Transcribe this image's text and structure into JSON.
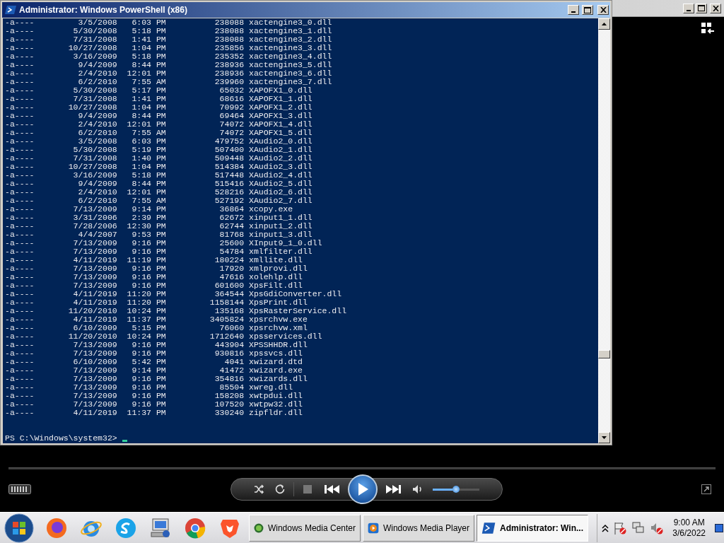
{
  "media_player": {
    "volume": {
      "level": 0.5
    }
  },
  "powershell_window": {
    "title": "Administrator: Windows PowerShell (x86)",
    "rows": [
      {
        "mode": "-a----",
        "date": "3/5/2008",
        "time": "6:03 PM",
        "size": "238088",
        "name": "xactengine3_0.dll"
      },
      {
        "mode": "-a----",
        "date": "5/30/2008",
        "time": "5:18 PM",
        "size": "238088",
        "name": "xactengine3_1.dll"
      },
      {
        "mode": "-a----",
        "date": "7/31/2008",
        "time": "1:41 PM",
        "size": "238088",
        "name": "xactengine3_2.dll"
      },
      {
        "mode": "-a----",
        "date": "10/27/2008",
        "time": "1:04 PM",
        "size": "235856",
        "name": "xactengine3_3.dll"
      },
      {
        "mode": "-a----",
        "date": "3/16/2009",
        "time": "5:18 PM",
        "size": "235352",
        "name": "xactengine3_4.dll"
      },
      {
        "mode": "-a----",
        "date": "9/4/2009",
        "time": "8:44 PM",
        "size": "238936",
        "name": "xactengine3_5.dll"
      },
      {
        "mode": "-a----",
        "date": "2/4/2010",
        "time": "12:01 PM",
        "size": "238936",
        "name": "xactengine3_6.dll"
      },
      {
        "mode": "-a----",
        "date": "6/2/2010",
        "time": "7:55 AM",
        "size": "239960",
        "name": "xactengine3_7.dll"
      },
      {
        "mode": "-a----",
        "date": "5/30/2008",
        "time": "5:17 PM",
        "size": "65032",
        "name": "XAPOFX1_0.dll"
      },
      {
        "mode": "-a----",
        "date": "7/31/2008",
        "time": "1:41 PM",
        "size": "68616",
        "name": "XAPOFX1_1.dll"
      },
      {
        "mode": "-a----",
        "date": "10/27/2008",
        "time": "1:04 PM",
        "size": "70992",
        "name": "XAPOFX1_2.dll"
      },
      {
        "mode": "-a----",
        "date": "9/4/2009",
        "time": "8:44 PM",
        "size": "69464",
        "name": "XAPOFX1_3.dll"
      },
      {
        "mode": "-a----",
        "date": "2/4/2010",
        "time": "12:01 PM",
        "size": "74072",
        "name": "XAPOFX1_4.dll"
      },
      {
        "mode": "-a----",
        "date": "6/2/2010",
        "time": "7:55 AM",
        "size": "74072",
        "name": "XAPOFX1_5.dll"
      },
      {
        "mode": "-a----",
        "date": "3/5/2008",
        "time": "6:03 PM",
        "size": "479752",
        "name": "XAudio2_0.dll"
      },
      {
        "mode": "-a----",
        "date": "5/30/2008",
        "time": "5:19 PM",
        "size": "507400",
        "name": "XAudio2_1.dll"
      },
      {
        "mode": "-a----",
        "date": "7/31/2008",
        "time": "1:40 PM",
        "size": "509448",
        "name": "XAudio2_2.dll"
      },
      {
        "mode": "-a----",
        "date": "10/27/2008",
        "time": "1:04 PM",
        "size": "514384",
        "name": "XAudio2_3.dll"
      },
      {
        "mode": "-a----",
        "date": "3/16/2009",
        "time": "5:18 PM",
        "size": "517448",
        "name": "XAudio2_4.dll"
      },
      {
        "mode": "-a----",
        "date": "9/4/2009",
        "time": "8:44 PM",
        "size": "515416",
        "name": "XAudio2_5.dll"
      },
      {
        "mode": "-a----",
        "date": "2/4/2010",
        "time": "12:01 PM",
        "size": "528216",
        "name": "XAudio2_6.dll"
      },
      {
        "mode": "-a----",
        "date": "6/2/2010",
        "time": "7:55 AM",
        "size": "527192",
        "name": "XAudio2_7.dll"
      },
      {
        "mode": "-a----",
        "date": "7/13/2009",
        "time": "9:14 PM",
        "size": "36864",
        "name": "xcopy.exe"
      },
      {
        "mode": "-a----",
        "date": "3/31/2006",
        "time": "2:39 PM",
        "size": "62672",
        "name": "xinput1_1.dll"
      },
      {
        "mode": "-a----",
        "date": "7/28/2006",
        "time": "12:30 PM",
        "size": "62744",
        "name": "xinput1_2.dll"
      },
      {
        "mode": "-a----",
        "date": "4/4/2007",
        "time": "9:53 PM",
        "size": "81768",
        "name": "xinput1_3.dll"
      },
      {
        "mode": "-a----",
        "date": "7/13/2009",
        "time": "9:16 PM",
        "size": "25600",
        "name": "XInput9_1_0.dll"
      },
      {
        "mode": "-a----",
        "date": "7/13/2009",
        "time": "9:16 PM",
        "size": "54784",
        "name": "xmlfilter.dll"
      },
      {
        "mode": "-a----",
        "date": "4/11/2019",
        "time": "11:19 PM",
        "size": "180224",
        "name": "xmllite.dll"
      },
      {
        "mode": "-a----",
        "date": "7/13/2009",
        "time": "9:16 PM",
        "size": "17920",
        "name": "xmlprovi.dll"
      },
      {
        "mode": "-a----",
        "date": "7/13/2009",
        "time": "9:16 PM",
        "size": "47616",
        "name": "xolehlp.dll"
      },
      {
        "mode": "-a----",
        "date": "7/13/2009",
        "time": "9:16 PM",
        "size": "601600",
        "name": "XpsFilt.dll"
      },
      {
        "mode": "-a----",
        "date": "4/11/2019",
        "time": "11:20 PM",
        "size": "364544",
        "name": "XpsGdiConverter.dll"
      },
      {
        "mode": "-a----",
        "date": "4/11/2019",
        "time": "11:20 PM",
        "size": "1158144",
        "name": "XpsPrint.dll"
      },
      {
        "mode": "-a----",
        "date": "11/20/2010",
        "time": "10:24 PM",
        "size": "135168",
        "name": "XpsRasterService.dll"
      },
      {
        "mode": "-a----",
        "date": "4/11/2019",
        "time": "11:37 PM",
        "size": "3405824",
        "name": "xpsrchvw.exe"
      },
      {
        "mode": "-a----",
        "date": "6/10/2009",
        "time": "5:15 PM",
        "size": "76060",
        "name": "xpsrchvw.xml"
      },
      {
        "mode": "-a----",
        "date": "11/20/2010",
        "time": "10:24 PM",
        "size": "1712640",
        "name": "xpsservices.dll"
      },
      {
        "mode": "-a----",
        "date": "7/13/2009",
        "time": "9:16 PM",
        "size": "443904",
        "name": "XPSSHHDR.dll"
      },
      {
        "mode": "-a----",
        "date": "7/13/2009",
        "time": "9:16 PM",
        "size": "930816",
        "name": "xpssvcs.dll"
      },
      {
        "mode": "-a----",
        "date": "6/10/2009",
        "time": "5:42 PM",
        "size": "4041",
        "name": "xwizard.dtd"
      },
      {
        "mode": "-a----",
        "date": "7/13/2009",
        "time": "9:14 PM",
        "size": "41472",
        "name": "xwizard.exe"
      },
      {
        "mode": "-a----",
        "date": "7/13/2009",
        "time": "9:16 PM",
        "size": "354816",
        "name": "xwizards.dll"
      },
      {
        "mode": "-a----",
        "date": "7/13/2009",
        "time": "9:16 PM",
        "size": "85504",
        "name": "xwreg.dll"
      },
      {
        "mode": "-a----",
        "date": "7/13/2009",
        "time": "9:16 PM",
        "size": "158208",
        "name": "xwtpdui.dll"
      },
      {
        "mode": "-a----",
        "date": "7/13/2009",
        "time": "9:16 PM",
        "size": "107520",
        "name": "xwtpw32.dll"
      },
      {
        "mode": "-a----",
        "date": "4/11/2019",
        "time": "11:37 PM",
        "size": "330240",
        "name": "zipfldr.dll"
      }
    ],
    "prompt": "PS C:\\Windows\\system32>"
  },
  "taskbar": {
    "tasks": [
      {
        "kind": "media-center",
        "label": "Windows Media Center",
        "selected": false
      },
      {
        "kind": "media-player",
        "label": "Windows Media Player",
        "selected": false
      },
      {
        "kind": "powershell",
        "label": "Administrator: Win...",
        "selected": true
      }
    ],
    "clock": {
      "time": "9:00 AM",
      "date": "3/6/2022"
    }
  }
}
